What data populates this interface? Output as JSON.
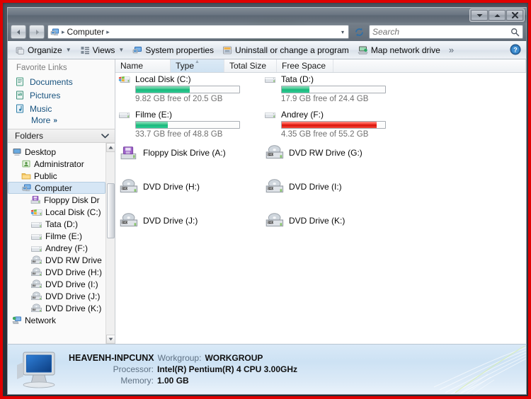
{
  "window": {
    "title": "Computer",
    "controls": {
      "minimize": "Minimize",
      "maximize": "Maximize",
      "close": "Close"
    }
  },
  "address": {
    "back": "Back",
    "forward": "Forward",
    "crumbs": [
      "Computer"
    ],
    "refresh": "Refresh",
    "history_caret": "▾"
  },
  "search": {
    "placeholder": "Search",
    "value": ""
  },
  "toolbar": {
    "organize": "Organize",
    "views": "Views",
    "system_properties": "System properties",
    "uninstall": "Uninstall or change a program",
    "map_network_drive": "Map network drive",
    "more": "»",
    "help": "Help"
  },
  "sidebar": {
    "favorites_header": "Favorite Links",
    "favorites": [
      {
        "label": "Documents",
        "icon": "documents-icon"
      },
      {
        "label": "Pictures",
        "icon": "pictures-icon"
      },
      {
        "label": "Music",
        "icon": "music-icon"
      }
    ],
    "more_label": "More",
    "more_chevron": "»",
    "folders_header": "Folders",
    "folders_chevron": "⌄",
    "tree": [
      {
        "label": "Desktop",
        "indent": 0,
        "icon": "desktop-icon",
        "selected": false
      },
      {
        "label": "Administrator",
        "indent": 1,
        "icon": "user-folder-icon",
        "selected": false
      },
      {
        "label": "Public",
        "indent": 1,
        "icon": "folder-icon",
        "selected": false
      },
      {
        "label": "Computer",
        "indent": 1,
        "icon": "computer-icon",
        "selected": true
      },
      {
        "label": "Floppy Disk Dr",
        "indent": 2,
        "icon": "floppy-icon",
        "selected": false
      },
      {
        "label": "Local Disk (C:)",
        "indent": 2,
        "icon": "system-disk-icon",
        "selected": false
      },
      {
        "label": "Tata (D:)",
        "indent": 2,
        "icon": "disk-icon",
        "selected": false
      },
      {
        "label": "Filme (E:)",
        "indent": 2,
        "icon": "disk-icon",
        "selected": false
      },
      {
        "label": "Andrey (F:)",
        "indent": 2,
        "icon": "disk-icon",
        "selected": false
      },
      {
        "label": "DVD RW Drive",
        "indent": 2,
        "icon": "dvd-icon",
        "selected": false
      },
      {
        "label": "DVD Drive (H:)",
        "indent": 2,
        "icon": "dvd-icon",
        "selected": false
      },
      {
        "label": "DVD Drive (I:)",
        "indent": 2,
        "icon": "dvd-icon",
        "selected": false
      },
      {
        "label": "DVD Drive (J:)",
        "indent": 2,
        "icon": "dvd-icon",
        "selected": false
      },
      {
        "label": "DVD Drive (K:)",
        "indent": 2,
        "icon": "dvd-icon",
        "selected": false
      },
      {
        "label": "Network",
        "indent": 0,
        "icon": "network-icon",
        "selected": false
      }
    ]
  },
  "columns": [
    {
      "label": "Name",
      "width": 78,
      "active": false,
      "sorted": false
    },
    {
      "label": "Type",
      "width": 76,
      "active": true,
      "sorted": true,
      "sort_arrow": "▲"
    },
    {
      "label": "Total Size",
      "width": 74,
      "active": false,
      "sorted": false
    },
    {
      "label": "Free Space",
      "width": 80,
      "active": false,
      "sorted": false
    }
  ],
  "drives": {
    "hard_disks": [
      {
        "name": "Local Disk (C:)",
        "free_text": "9.82 GB free of 20.5 GB",
        "free_gb": 9.82,
        "total_gb": 20.5,
        "used_pct": 52,
        "bar_color": "green",
        "icon": "system-disk-icon"
      },
      {
        "name": "Tata (D:)",
        "free_text": "17.9 GB free of 24.4 GB",
        "free_gb": 17.9,
        "total_gb": 24.4,
        "used_pct": 27,
        "bar_color": "green",
        "icon": "disk-icon"
      },
      {
        "name": "Filme (E:)",
        "free_text": "33.7 GB free of 48.8 GB",
        "free_gb": 33.7,
        "total_gb": 48.8,
        "used_pct": 31,
        "bar_color": "green",
        "icon": "disk-icon"
      },
      {
        "name": "Andrey (F:)",
        "free_text": "4.35 GB free of 55.2 GB",
        "free_gb": 4.35,
        "total_gb": 55.2,
        "used_pct": 92,
        "bar_color": "red",
        "icon": "disk-icon"
      }
    ],
    "removable": [
      {
        "name": "Floppy Disk Drive (A:)",
        "icon": "floppy-icon"
      },
      {
        "name": "DVD RW Drive (G:)",
        "icon": "dvd-icon"
      },
      {
        "name": "DVD Drive (H:)",
        "icon": "dvd-icon"
      },
      {
        "name": "DVD Drive (I:)",
        "icon": "dvd-icon"
      },
      {
        "name": "DVD Drive (J:)",
        "icon": "dvd-icon"
      },
      {
        "name": "DVD Drive (K:)",
        "icon": "dvd-icon"
      }
    ]
  },
  "status": {
    "computer_name": "HEAVENH-INPCUNX",
    "workgroup_key": "Workgroup:",
    "workgroup_value": "WORKGROUP",
    "processor_key": "Processor:",
    "processor_value": "Intel(R) Pentium(R) 4 CPU 3.00GHz",
    "memory_key": "Memory:",
    "memory_value": "1.00 GB"
  },
  "colors": {
    "frame_red": "#e00000",
    "bar_green": "#18b87b",
    "bar_red": "#d60e08",
    "link_blue": "#17527e",
    "status_bg": "#cde2f4"
  }
}
